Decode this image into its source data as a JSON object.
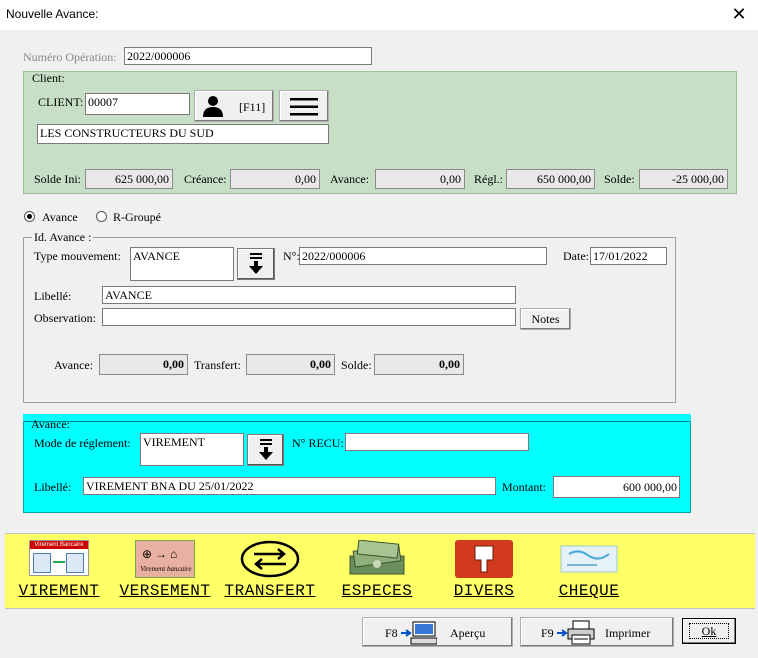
{
  "window": {
    "title": "Nouvelle Avance:",
    "close_glyph": "✕"
  },
  "operation": {
    "label": "Numéro Opération:",
    "value": "2022/000006"
  },
  "client": {
    "legend": "Client:",
    "code_label": "CLIENT:",
    "code_value": "00007",
    "f11_label": "[F11]",
    "name": "LES CONSTRUCTEURS DU SUD",
    "solde_ini_label": "Solde Ini:",
    "solde_ini": "625 000,00",
    "creance_label": "Créance:",
    "creance": "0,00",
    "avance_label": "Avance:",
    "avance": "0,00",
    "regl_label": "Régl.:",
    "regl": "650 000,00",
    "solde_label": "Solde:",
    "solde": "-25 000,00",
    "bg_color": "#c6dfc6"
  },
  "mode": {
    "avance": "Avance",
    "rgroupe": "R-Groupé",
    "selected": "avance"
  },
  "id_avance": {
    "legend": "Id. Avance :",
    "type_label": "Type mouvement:",
    "type_value": "AVANCE",
    "num_label": "N°:",
    "num_value": "2022/000006",
    "date_label": "Date:",
    "date_value": "17/01/2022",
    "libelle_label": "Libellé:",
    "libelle_value": "AVANCE",
    "observation_label": "Observation:",
    "observation_value": "",
    "notes_label": "Notes",
    "avance_label": "Avance:",
    "avance_value": "0,00",
    "transfert_label": "Transfert:",
    "transfert_value": "0,00",
    "solde_label": "Solde:",
    "solde_value": "0,00"
  },
  "avance": {
    "legend": "Avance:",
    "mode_label": "Mode de réglement:",
    "mode_value": "VIREMENT",
    "recu_label": "N° RECU:",
    "recu_value": "",
    "libelle_label": "Libellé:",
    "libelle_value": "VIREMENT BNA DU 25/01/2022",
    "montant_label": "Montant:",
    "montant_value": "600 000,00",
    "bg_color": "#00ffff"
  },
  "toolbar": {
    "bg_color": "#ffff66",
    "virement": "VIREMENT",
    "versement": "VERSEMENT",
    "transfert": "TRANSFERT",
    "especes": "ESPECES",
    "divers": "DIVERS",
    "cheque": "CHEQUE",
    "virement_icon_text": "Virement Bancaire",
    "versement_icon_text": "Virement bancaire"
  },
  "footer": {
    "f8_key": "F8",
    "apercu": "Aperçu",
    "f9_key": "F9",
    "imprimer": "Imprimer",
    "ok": "Ok"
  }
}
